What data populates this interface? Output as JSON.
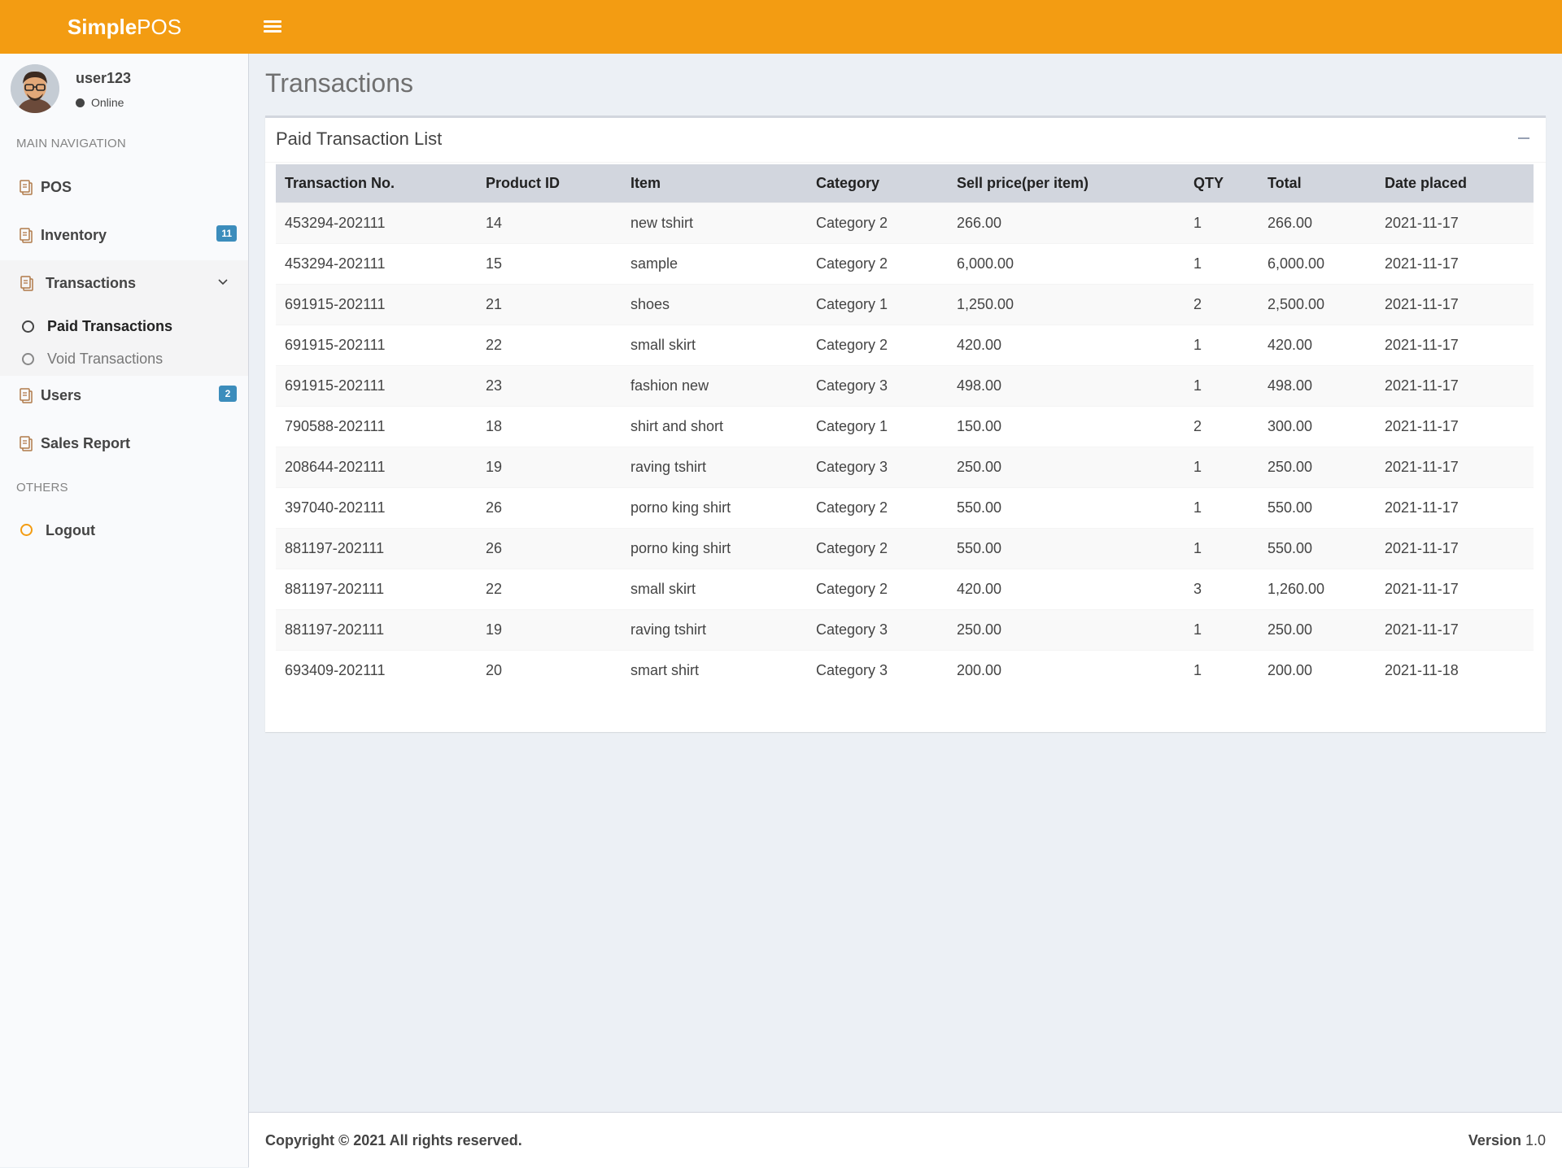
{
  "brand": {
    "bold": "Simple",
    "light": "POS",
    "color": "#f39c12"
  },
  "user": {
    "name": "user123",
    "status": "Online"
  },
  "nav": {
    "main_header": "MAIN NAVIGATION",
    "others_header": "OTHERS",
    "items": {
      "pos": {
        "label": "POS",
        "icon": "clipboard-icon"
      },
      "inventory": {
        "label": "Inventory",
        "badge": "11",
        "icon": "clipboard-icon"
      },
      "transactions": {
        "label": "Transactions",
        "icon": "clipboard-icon",
        "expanded": true
      },
      "paid_transactions": {
        "label": "Paid Transactions",
        "active": true
      },
      "void_transactions": {
        "label": "Void Transactions"
      },
      "users": {
        "label": "Users",
        "badge": "2",
        "icon": "clipboard-icon"
      },
      "sales_report": {
        "label": "Sales Report",
        "icon": "clipboard-icon"
      },
      "logout": {
        "label": "Logout",
        "icon": "circle-icon"
      }
    }
  },
  "page": {
    "title": "Transactions"
  },
  "box": {
    "title": "Paid Transaction List",
    "columns": [
      "Transaction No.",
      "Product ID",
      "Item",
      "Category",
      "Sell price(per item)",
      "QTY",
      "Total",
      "Date placed"
    ],
    "rows": [
      [
        "453294-202111",
        "14",
        "new tshirt",
        "Category 2",
        "266.00",
        "1",
        "266.00",
        "2021-11-17"
      ],
      [
        "453294-202111",
        "15",
        "sample",
        "Category 2",
        "6,000.00",
        "1",
        "6,000.00",
        "2021-11-17"
      ],
      [
        "691915-202111",
        "21",
        "shoes",
        "Category 1",
        "1,250.00",
        "2",
        "2,500.00",
        "2021-11-17"
      ],
      [
        "691915-202111",
        "22",
        "small skirt",
        "Category 2",
        "420.00",
        "1",
        "420.00",
        "2021-11-17"
      ],
      [
        "691915-202111",
        "23",
        "fashion new",
        "Category 3",
        "498.00",
        "1",
        "498.00",
        "2021-11-17"
      ],
      [
        "790588-202111",
        "18",
        "shirt and short",
        "Category 1",
        "150.00",
        "2",
        "300.00",
        "2021-11-17"
      ],
      [
        "208644-202111",
        "19",
        "raving tshirt",
        "Category 3",
        "250.00",
        "1",
        "250.00",
        "2021-11-17"
      ],
      [
        "397040-202111",
        "26",
        "porno king shirt",
        "Category 2",
        "550.00",
        "1",
        "550.00",
        "2021-11-17"
      ],
      [
        "881197-202111",
        "26",
        "porno king shirt",
        "Category 2",
        "550.00",
        "1",
        "550.00",
        "2021-11-17"
      ],
      [
        "881197-202111",
        "22",
        "small skirt",
        "Category 2",
        "420.00",
        "3",
        "1,260.00",
        "2021-11-17"
      ],
      [
        "881197-202111",
        "19",
        "raving tshirt",
        "Category 3",
        "250.00",
        "1",
        "250.00",
        "2021-11-17"
      ],
      [
        "693409-202111",
        "20",
        "smart shirt",
        "Category 3",
        "200.00",
        "1",
        "200.00",
        "2021-11-18"
      ]
    ]
  },
  "footer": {
    "copyright": "Copyright © 2021 All rights reserved.",
    "version_label": "Version",
    "version_number": "1.0"
  }
}
